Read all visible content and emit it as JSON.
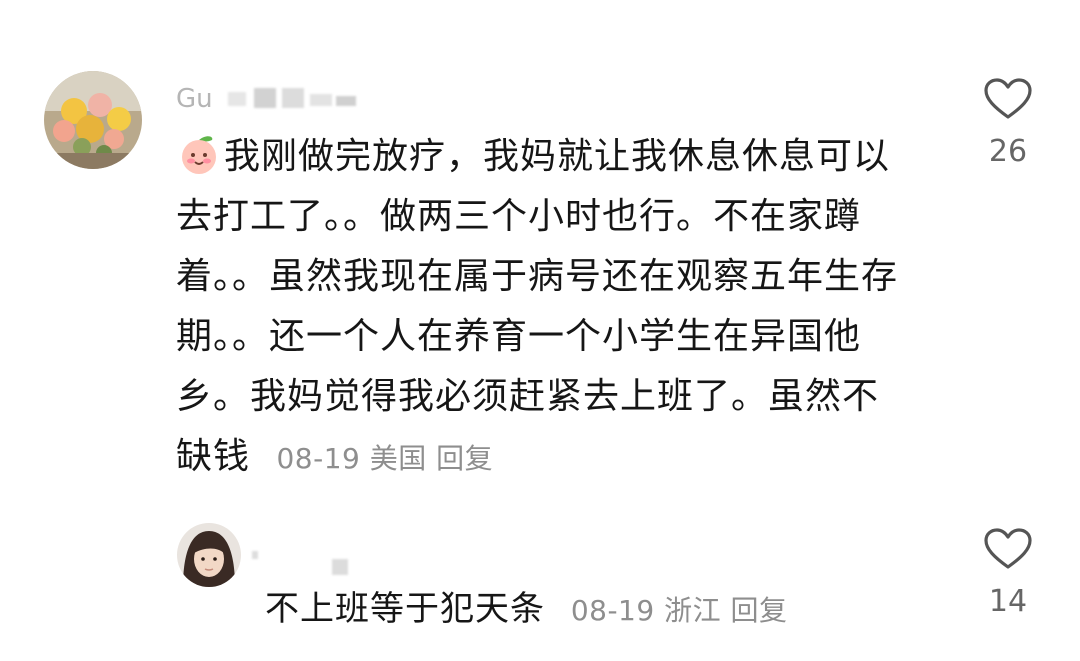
{
  "comments": [
    {
      "username": "Gu",
      "emoji": "peach-face-emoji",
      "lines": [
        "我刚做完放疗，我妈就让我休息休息可以",
        "去打工了。。做两三个小时也行。不在家蹲",
        "着。。虽然我现在属于病号还在观察五年生存",
        "期。。还一个人在养育一个小学生在异国他",
        "乡。我妈觉得我必须赶紧去上班了。虽然不"
      ],
      "last_line": "缺钱",
      "date": "08-19",
      "location": "美国",
      "reply_label": "回复",
      "like_count": "26"
    }
  ],
  "replies": [
    {
      "text": "不上班等于犯天条",
      "date": "08-19",
      "location": "浙江",
      "reply_label": "回复",
      "like_count": "14"
    }
  ],
  "colors": {
    "meta": "#8e8e8e",
    "text": "#161616",
    "like_count": "#666666"
  }
}
